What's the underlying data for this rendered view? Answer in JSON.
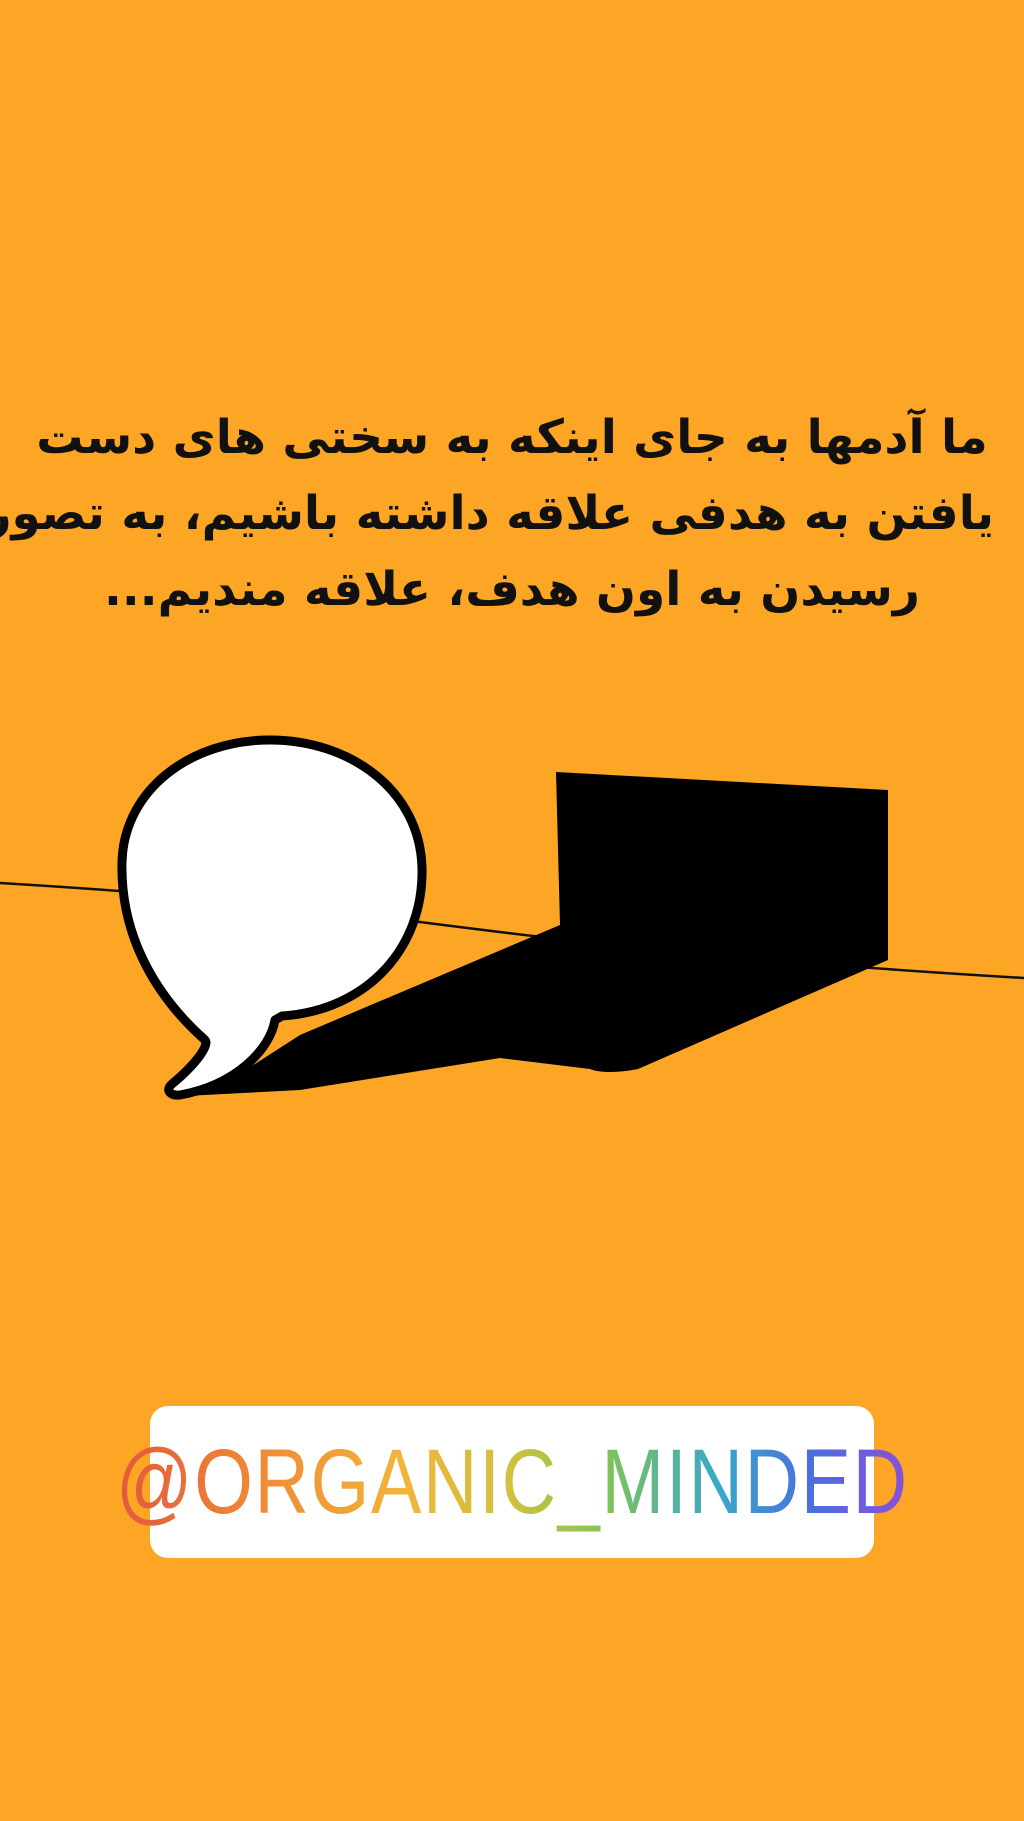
{
  "caption": {
    "lines": [
      "ما آدمها به جای اینکه به سختی های دست",
      "یافتن به هدفی علاقه داشته باشیم، به تصور",
      "رسیدن به اون هدف، علاقه مندیم..."
    ]
  },
  "sticker": {
    "mention": "@ORGANIC_MINDED"
  },
  "colors": {
    "background": "#fda524",
    "text": "#111111",
    "bubble": "#ffffff",
    "shadow": "#000000"
  }
}
